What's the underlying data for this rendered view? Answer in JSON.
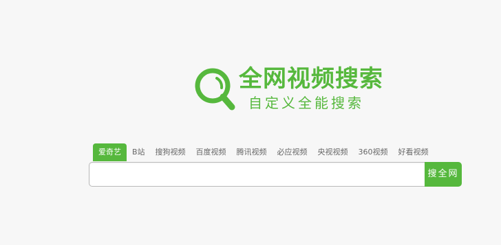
{
  "logo": {
    "title": "全网视频搜索",
    "subtitle": "自定义全能搜索",
    "icon": "magnifier-logo-icon",
    "color": "#56b83d"
  },
  "tabs": [
    {
      "label": "爱奇艺",
      "active": true
    },
    {
      "label": "B站",
      "active": false
    },
    {
      "label": "搜狗视频",
      "active": false
    },
    {
      "label": "百度视频",
      "active": false
    },
    {
      "label": "腾讯视频",
      "active": false
    },
    {
      "label": "必应视频",
      "active": false
    },
    {
      "label": "央视视频",
      "active": false
    },
    {
      "label": "360视频",
      "active": false
    },
    {
      "label": "好看视频",
      "active": false
    }
  ],
  "search": {
    "value": "",
    "placeholder": "",
    "button_label": "搜全网"
  },
  "colors": {
    "accent": "#56b83d",
    "background": "#f7f7f7"
  }
}
